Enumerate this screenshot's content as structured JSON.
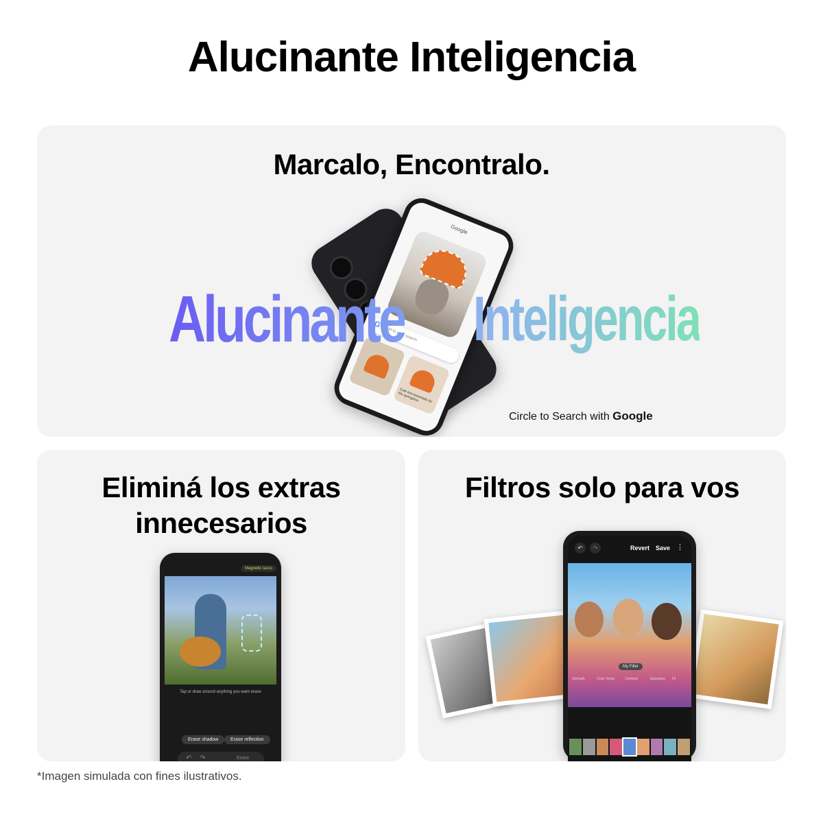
{
  "main_title": "Alucinante Inteligencia",
  "hero": {
    "title": "Marcalo, Encontralo.",
    "word_left": "Alucinante",
    "word_right": "Inteligencia",
    "phone": {
      "google_label": "Google",
      "search_placeholder": "Add to your search",
      "result_caption": "Cute knit essentials for the springtime"
    },
    "caption_prefix": "Circle to Search with",
    "caption_brand": "Google"
  },
  "eraser": {
    "title_line1": "Eliminá los extras",
    "title_line2": "innecesarios",
    "phone": {
      "mode_chip": "Magnetic lasso",
      "hint": "Tap or draw around anything you want erase",
      "erase_shadow": "Erase shadow",
      "erase_reflection": "Erase reflection",
      "erase_button": "Erase"
    }
  },
  "filters": {
    "title": "Filtros solo para vos",
    "phone": {
      "revert": "Revert",
      "save": "Save",
      "filter_name": "My Filter",
      "controls": [
        "Strength",
        "Color Temp",
        "Contrast",
        "Saturation",
        "Fil"
      ]
    }
  },
  "footnote": "*Imagen simulada con fines ilustrativos.",
  "colors": {
    "card_bg": "#f3f3f3",
    "word_left_start": "#6a5cf2",
    "word_left_end": "#7f9ef0",
    "word_right_start": "#8fb0f0",
    "word_right_end": "#7fe0b8"
  }
}
